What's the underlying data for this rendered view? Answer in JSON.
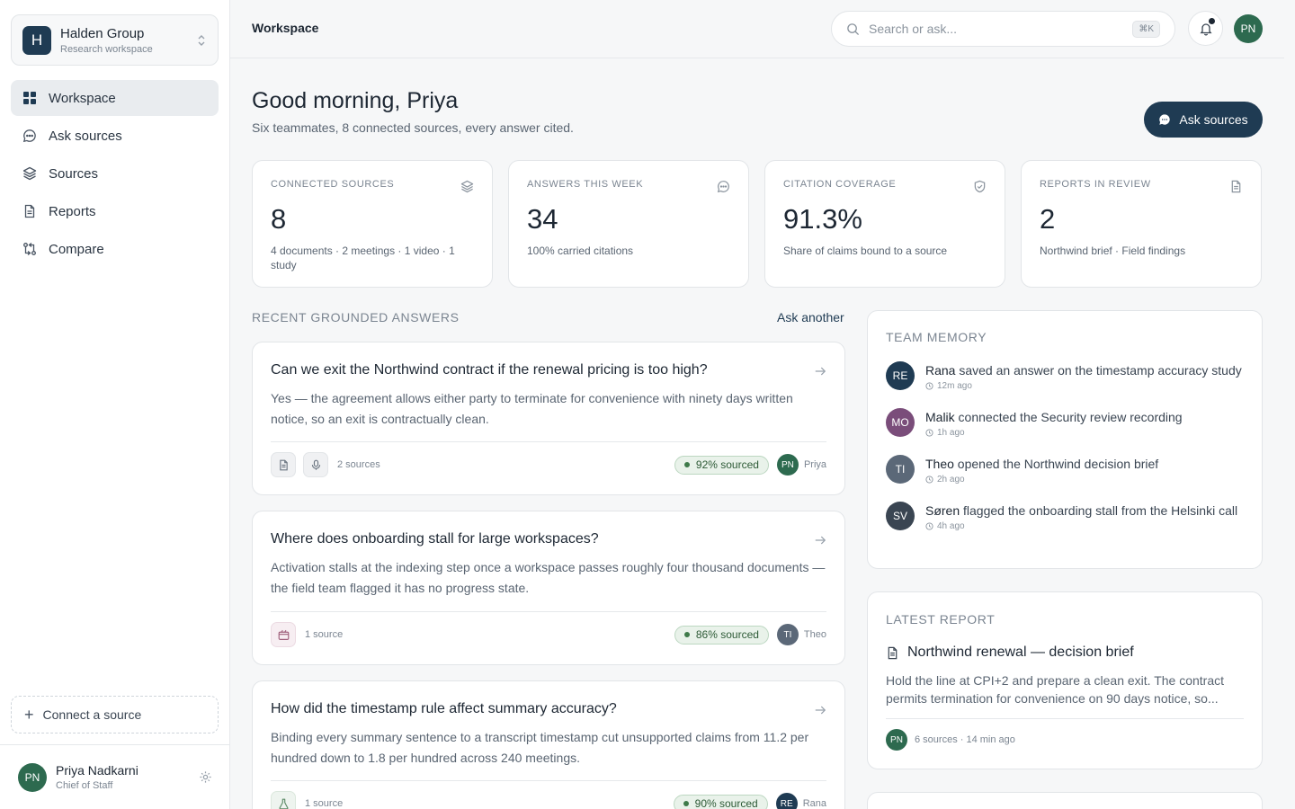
{
  "colors": {
    "brand": "#1f3b53",
    "sourced_green": "#3f7a4a",
    "rana": "#1f3b53",
    "malik": "#7a4d7a",
    "theo": "#5b6878",
    "soren": "#3a4552",
    "priya": "#2d6a4f"
  },
  "workspace": {
    "logo_letter": "H",
    "name": "Halden Group",
    "subtitle": "Research workspace"
  },
  "nav": [
    {
      "label": "Workspace",
      "icon": "grid-icon",
      "active": true
    },
    {
      "label": "Ask sources",
      "icon": "chat-icon"
    },
    {
      "label": "Sources",
      "icon": "layers-icon"
    },
    {
      "label": "Reports",
      "icon": "document-icon"
    },
    {
      "label": "Compare",
      "icon": "compare-icon"
    }
  ],
  "connect_label": "Connect a source",
  "user": {
    "initials": "PN",
    "name": "Priya Nadkarni",
    "role": "Chief of Staff"
  },
  "topbar": {
    "title": "Workspace",
    "search_placeholder": "Search or ask...",
    "shortcut": "⌘K"
  },
  "greeting": {
    "title": "Good morning, Priya",
    "subtitle": "Six teammates, 8 connected sources, every answer cited.",
    "cta": "Ask sources"
  },
  "stats": [
    {
      "label": "Connected sources",
      "value": "8",
      "sub": "4 documents · 2 meetings · 1 video · 1 study"
    },
    {
      "label": "Answers this week",
      "value": "34",
      "sub": "100% carried citations"
    },
    {
      "label": "Citation coverage",
      "value": "91.3%",
      "sub": "Share of claims bound to a source"
    },
    {
      "label": "Reports in review",
      "value": "2",
      "sub": "Northwind brief · Field findings"
    }
  ],
  "answers_section": {
    "title": "Recent grounded answers",
    "action": "Ask another"
  },
  "answers": [
    {
      "question": "Can we exit the Northwind contract if the renewal pricing is too high?",
      "answer": "Yes — the agreement allows either party to terminate for convenience with ninety days written notice, so an exit is contractually clean.",
      "sources": "2 sources",
      "sourced": "92% sourced",
      "author_initials": "PN",
      "author": "Priya"
    },
    {
      "question": "Where does onboarding stall for large workspaces?",
      "answer": "Activation stalls at the indexing step once a workspace passes roughly four thousand documents — the field team flagged it has no progress state.",
      "sources": "1 source",
      "sourced": "86% sourced",
      "author_initials": "TI",
      "author": "Theo"
    },
    {
      "question": "How did the timestamp rule affect summary accuracy?",
      "answer": "Binding every summary sentence to a transcript timestamp cut unsupported claims from 11.2 per hundred down to 1.8 per hundred across 240 meetings.",
      "sources": "1 source",
      "sourced": "90% sourced",
      "author_initials": "RE",
      "author": "Rana"
    }
  ],
  "team_memory": {
    "title": "Team memory",
    "items": [
      {
        "initials": "RE",
        "name": "Rana",
        "text": " saved an answer on the timestamp accuracy study",
        "time": "12m ago"
      },
      {
        "initials": "MO",
        "name": "Malik",
        "text": " connected the Security review recording",
        "time": "1h ago"
      },
      {
        "initials": "TI",
        "name": "Theo",
        "text": " opened the Northwind decision brief",
        "time": "2h ago"
      },
      {
        "initials": "SV",
        "name": "Søren",
        "text": " flagged the onboarding stall from the Helsinki call",
        "time": "4h ago"
      }
    ]
  },
  "latest_report": {
    "title": "Latest report",
    "name": "Northwind renewal — decision brief",
    "summary": "Hold the line at CPI+2 and prepare a clean exit. The contract permits termination for convenience on 90 days notice, so...",
    "author_initials": "PN",
    "meta": "6 sources · 14 min ago"
  }
}
